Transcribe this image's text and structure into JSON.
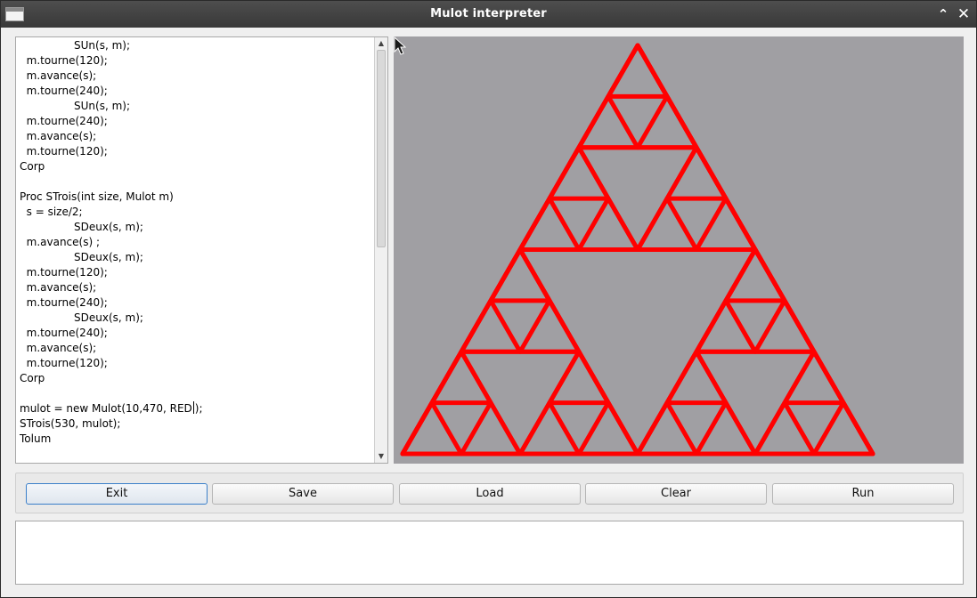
{
  "window": {
    "title": "Mulot interpreter",
    "maximize_icon": "chevron-up-icon",
    "close_icon": "close-icon"
  },
  "editor": {
    "lines": [
      "                SUn(s, m);",
      "  m.tourne(120);",
      "  m.avance(s);",
      "  m.tourne(240);",
      "                SUn(s, m);",
      "  m.tourne(240);",
      "  m.avance(s);",
      "  m.tourne(120);",
      "Corp",
      "",
      "Proc STrois(int size, Mulot m)",
      "  s = size/2;",
      "                SDeux(s, m);",
      "  m.avance(s) ;",
      "                SDeux(s, m);",
      "  m.tourne(120);",
      "  m.avance(s);",
      "  m.tourne(240);",
      "                SDeux(s, m);",
      "  m.tourne(240);",
      "  m.avance(s);",
      "  m.tourne(120);",
      "Corp",
      "",
      "mulot = new Mulot(10,470, RED);",
      "STrois(530, mulot);",
      "Tolum"
    ],
    "caret_line": 24,
    "caret_col": 29
  },
  "canvas": {
    "background": "#a09fa3",
    "stroke_color": "#ff0000",
    "figure": "sierpinski-triangle",
    "depth": 3
  },
  "buttons": {
    "exit": "Exit",
    "save": "Save",
    "load": "Load",
    "clear": "Clear",
    "run": "Run"
  },
  "output": {
    "text": ""
  }
}
